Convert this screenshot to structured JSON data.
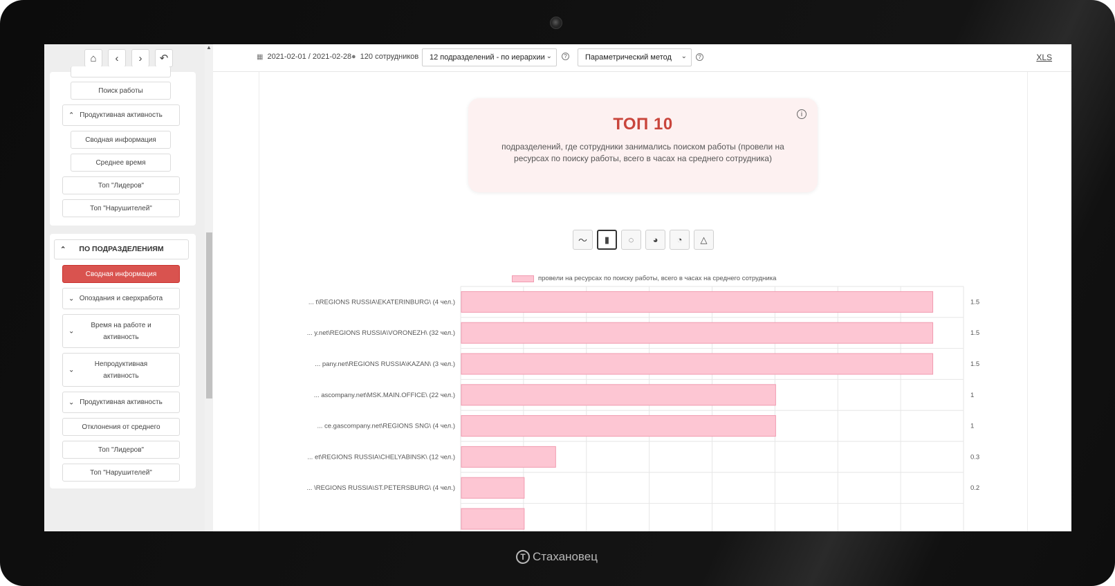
{
  "device": {
    "brand": "Стахановец"
  },
  "sidebar": {
    "top_items": [
      {
        "label": "Поиск работы"
      },
      {
        "label": "Продуктивная активность",
        "expanded": true
      },
      {
        "label": "Сводная информация"
      },
      {
        "label": "Среднее время"
      },
      {
        "label": "Топ \"Лидеров\""
      },
      {
        "label": "Топ \"Нарушителей\""
      }
    ],
    "section_title": "ПО ПОДРАЗДЕЛЕНИЯМ",
    "section_items": [
      {
        "label": "Сводная информация",
        "active": true
      },
      {
        "label": "Опоздания и сверхработа"
      },
      {
        "label": "Время на работе и активность"
      },
      {
        "label": "Непродуктивная активность"
      },
      {
        "label": "Продуктивная активность"
      },
      {
        "label": "Отклонения от среднего"
      },
      {
        "label": "Топ \"Лидеров\""
      },
      {
        "label": "Топ \"Нарушителей\""
      }
    ]
  },
  "toolbar": {
    "date_range": "2021-02-01 / 2021-02-28",
    "employees": "120 сотрудников",
    "grouping_select": "12 подразделений - по иерархии",
    "method_select": "Параметрический метод",
    "export_link": "XLS"
  },
  "card": {
    "title": "ТОП 10",
    "description": "подразделений, где сотрудники занимались поиском работы (провели на ресурсах по поиску работы, всего в часах на среднего сотрудника)"
  },
  "chart_types": [
    "line-chart-icon",
    "bar-chart-icon",
    "doughnut-chart-icon",
    "pie-chart-icon",
    "polar-chart-icon",
    "radar-chart-icon"
  ],
  "colors": {
    "bar_fill": "#fdc6d3",
    "bar_stroke": "#f19bb0",
    "accent": "#d9534f"
  },
  "chart_data": {
    "type": "bar",
    "orientation": "horizontal",
    "legend": [
      "провели на ресурсах по поиску работы, всего в часах на среднего сотрудника"
    ],
    "categories": [
      "... t\\REGIONS RUSSIA\\EKATERINBURG\\ (4 чел.)",
      "... y.net\\REGIONS RUSSIA\\VORONEZH\\ (32 чел.)",
      "... pany.net\\REGIONS RUSSIA\\KAZAN\\ (3 чел.)",
      "... ascompany.net\\MSK.MAIN.OFFICE\\ (22 чел.)",
      "... ce.gascompany.net\\REGIONS SNG\\ (4 чел.)",
      "... et\\REGIONS RUSSIA\\CHELYABINSK\\ (12 чел.)",
      "... \\REGIONS RUSSIA\\ST.PETERSBURG\\ (4 чел.)"
    ],
    "values": [
      1.5,
      1.5,
      1.5,
      1,
      1,
      0.3,
      0.2
    ],
    "value_labels": [
      "1.5",
      "1.5",
      "1.5",
      "1",
      "1",
      "0.3",
      "0.2"
    ],
    "extra_partial_bar_value": 0.2,
    "xlim": [
      0,
      1.6
    ],
    "grid": true
  }
}
